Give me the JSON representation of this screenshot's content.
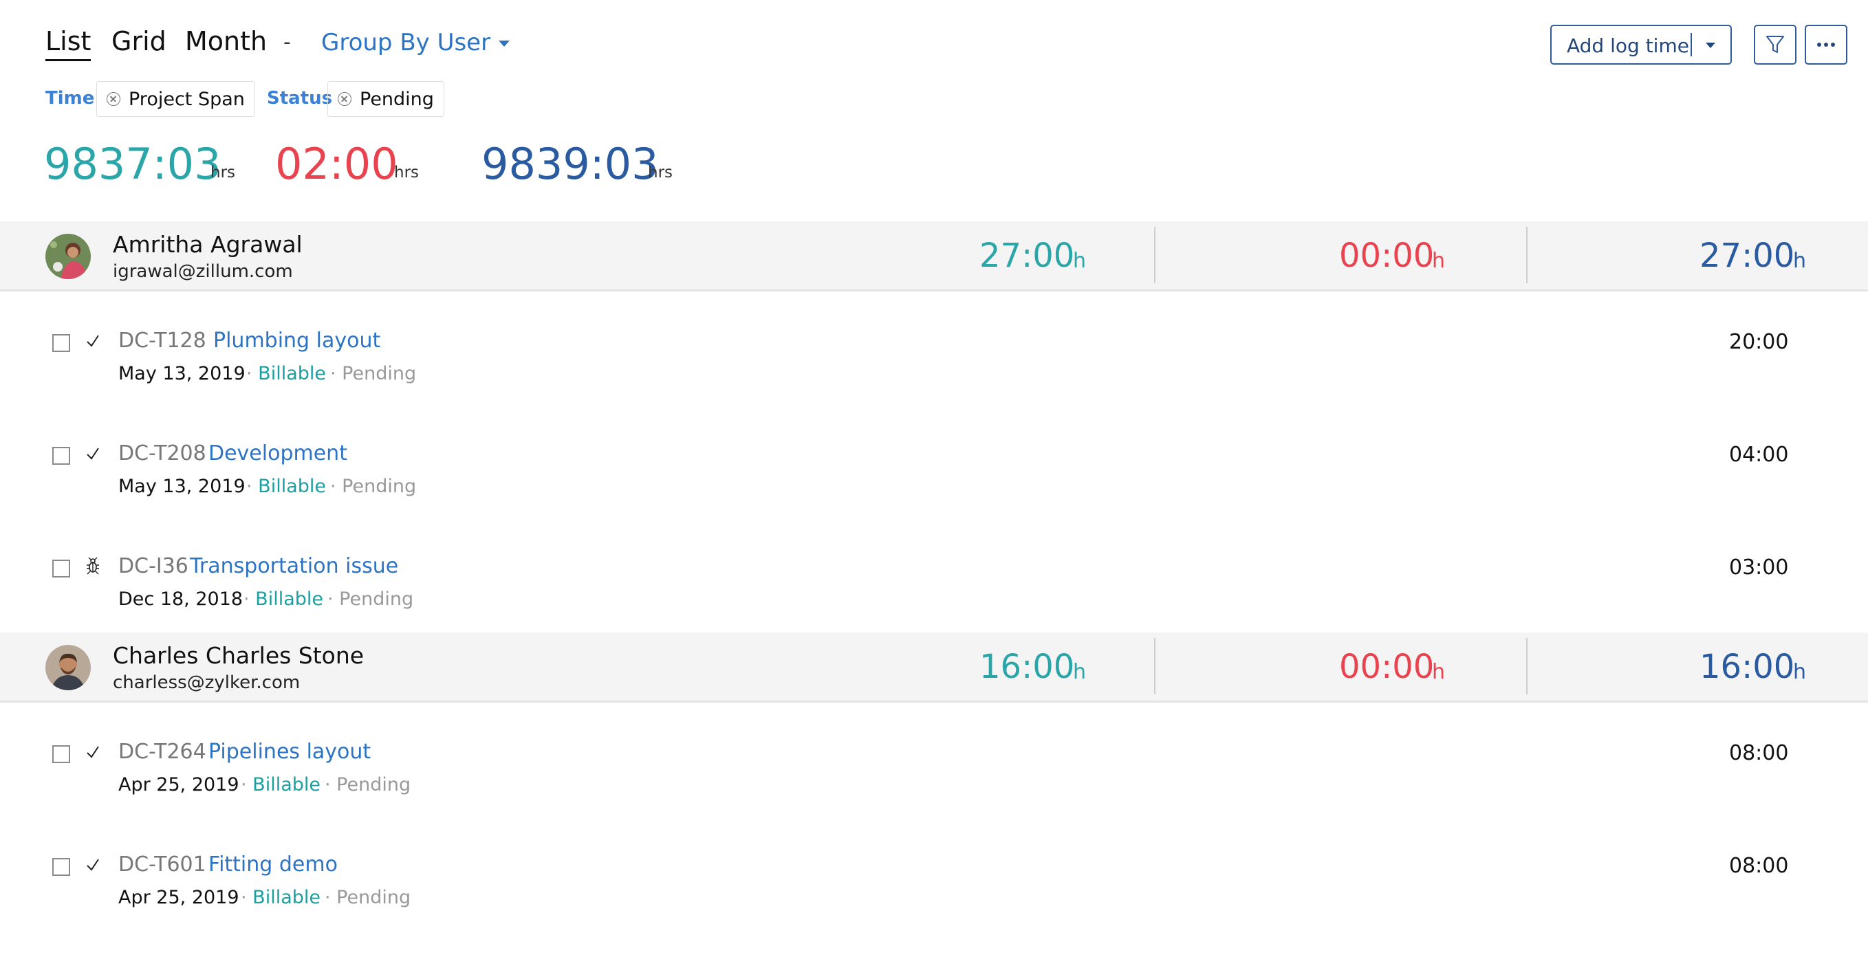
{
  "views": {
    "list": "List",
    "grid": "Grid",
    "month": "Month"
  },
  "separator": "-",
  "group_by": "Group By User",
  "toolbar": {
    "add_log_time": "Add log time"
  },
  "filters": [
    {
      "label": "Time",
      "value": "Project Span"
    },
    {
      "label": "Status",
      "value": "Pending"
    }
  ],
  "totals": [
    {
      "value": "9837:03",
      "unit": "hrs",
      "color": "#2aa5a8"
    },
    {
      "value": "02:00",
      "unit": "hrs",
      "color": "#e8434e"
    },
    {
      "value": "9839:03",
      "unit": "hrs",
      "color": "#2a5aa0"
    }
  ],
  "groups": [
    {
      "name": "Amritha Agrawal",
      "email": "igrawal@zillum.com",
      "totals": [
        "27:00",
        "00:00",
        "27:00"
      ],
      "unit": "h",
      "rows": [
        {
          "id": "DC-T128",
          "name": "Plumbing layout",
          "date": "May 13, 2019",
          "billing": "Billable",
          "status": "Pending",
          "duration": "20:00",
          "icon": "check-icon"
        },
        {
          "id": "DC-T208",
          "name": "Development",
          "date": "May 13, 2019",
          "billing": "Billable",
          "status": "Pending",
          "duration": "04:00",
          "icon": "check-icon"
        },
        {
          "id": "DC-I36",
          "name": "Transportation issue",
          "date": "Dec 18, 2018",
          "billing": "Billable",
          "status": "Pending",
          "duration": "03:00",
          "icon": "bug-icon"
        }
      ]
    },
    {
      "name": "Charles Charles Stone",
      "email": "charless@zylker.com",
      "totals": [
        "16:00",
        "00:00",
        "16:00"
      ],
      "unit": "h",
      "rows": [
        {
          "id": "DC-T264",
          "name": "Pipelines layout",
          "date": "Apr 25, 2019",
          "billing": "Billable",
          "status": "Pending",
          "duration": "08:00",
          "icon": "check-icon"
        },
        {
          "id": "DC-T601",
          "name": "Fitting demo",
          "date": "Apr 25, 2019",
          "billing": "Billable",
          "status": "Pending",
          "duration": "08:00",
          "icon": "check-icon"
        }
      ]
    }
  ]
}
